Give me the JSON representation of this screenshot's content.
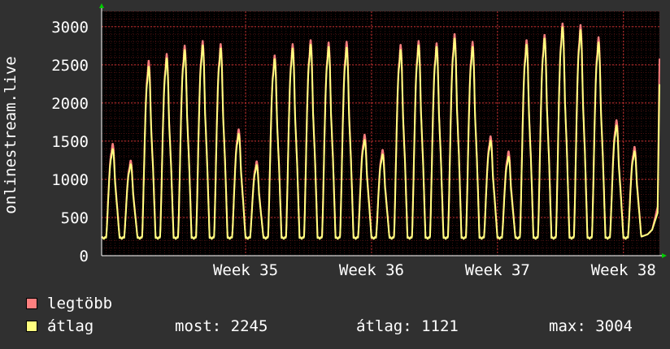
{
  "chart_data": {
    "type": "line",
    "ylabel": "onlinestream.live",
    "ylim": [
      0,
      3200
    ],
    "y_ticks": [
      0,
      500,
      1000,
      1500,
      2000,
      2500,
      3000
    ],
    "x_ticks": [
      {
        "label": "Week 35",
        "day": 8
      },
      {
        "label": "Week 36",
        "day": 15
      },
      {
        "label": "Week 37",
        "day": 22
      },
      {
        "label": "Week 38",
        "day": 29
      }
    ],
    "x_range_days": [
      0,
      31
    ],
    "grid": true,
    "legend_placement": "bottom-left",
    "background_color": "#000000",
    "grid_color": "#7a1e1e",
    "axis_color": "#ffffff",
    "daily_peaks": [
      {
        "max": 1470,
        "avg": 1400
      },
      {
        "max": 1250,
        "avg": 1200
      },
      {
        "max": 2560,
        "avg": 2480
      },
      {
        "max": 2650,
        "avg": 2590
      },
      {
        "max": 2760,
        "avg": 2700
      },
      {
        "max": 2820,
        "avg": 2760
      },
      {
        "max": 2780,
        "avg": 2720
      },
      {
        "max": 1660,
        "avg": 1600
      },
      {
        "max": 1240,
        "avg": 1190
      },
      {
        "max": 2630,
        "avg": 2580
      },
      {
        "max": 2780,
        "avg": 2720
      },
      {
        "max": 2830,
        "avg": 2770
      },
      {
        "max": 2800,
        "avg": 2740
      },
      {
        "max": 2810,
        "avg": 2730
      },
      {
        "max": 1590,
        "avg": 1520
      },
      {
        "max": 1390,
        "avg": 1330
      },
      {
        "max": 2770,
        "avg": 2700
      },
      {
        "max": 2820,
        "avg": 2760
      },
      {
        "max": 2790,
        "avg": 2740
      },
      {
        "max": 2910,
        "avg": 2850
      },
      {
        "max": 2810,
        "avg": 2740
      },
      {
        "max": 1570,
        "avg": 1510
      },
      {
        "max": 1370,
        "avg": 1300
      },
      {
        "max": 2830,
        "avg": 2770
      },
      {
        "max": 2900,
        "avg": 2850
      },
      {
        "max": 3050,
        "avg": 3000
      },
      {
        "max": 3030,
        "avg": 2960
      },
      {
        "max": 2870,
        "avg": 2800
      },
      {
        "max": 1780,
        "avg": 1710
      },
      {
        "max": 1430,
        "avg": 1370
      }
    ],
    "daily_min": 220,
    "last_value": {
      "max": 2580,
      "avg": 2245
    },
    "series": [
      {
        "name": "legtöbb",
        "color": "#ff7f7f"
      },
      {
        "name": "átlag",
        "color": "#ffff7f"
      }
    ]
  },
  "legend": {
    "max_label": "legtöbb",
    "avg_label": "átlag",
    "stats": {
      "now": "most: 2245",
      "avg": "átlag: 1121",
      "max": "max: 3004"
    }
  }
}
